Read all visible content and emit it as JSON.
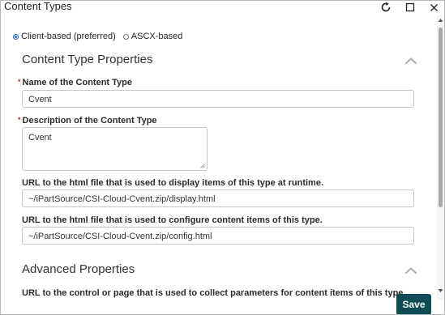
{
  "window": {
    "title": "Content Types",
    "buttons": [
      {
        "icon": "refresh-icon"
      },
      {
        "icon": "maximize-icon"
      },
      {
        "icon": "close-icon"
      }
    ]
  },
  "mode_options": [
    {
      "label": "Client-based (preferred)",
      "selected": true
    },
    {
      "label": "ASCX-based",
      "selected": false
    }
  ],
  "sections": {
    "content_type_properties": "Content Type Properties",
    "advanced_properties": "Advanced Properties"
  },
  "fields": {
    "name": {
      "label": "Name of the Content Type",
      "required": true,
      "value": "Cvent"
    },
    "description": {
      "label": "Description of the Content Type",
      "required": true,
      "value": "Cvent"
    },
    "display_url": {
      "label": "URL to the html file that is used to display items of this type at runtime.",
      "value": "~/iPartSource/CSI-Cloud-Cvent.zip/display.html"
    },
    "config_url": {
      "label": "URL to the html file that is used to configure content items of this type.",
      "value": "~/iPartSource/CSI-Cloud-Cvent.zip/config.html"
    },
    "control_url": {
      "label": "URL to the control or page that is used to collect parameters for content items of this type."
    }
  },
  "required_marker": "*",
  "footer": {
    "save_label": "Save"
  },
  "colors": {
    "accent": "#1a6fc4",
    "save_bg": "#0f4d56",
    "required": "#c0392b"
  }
}
